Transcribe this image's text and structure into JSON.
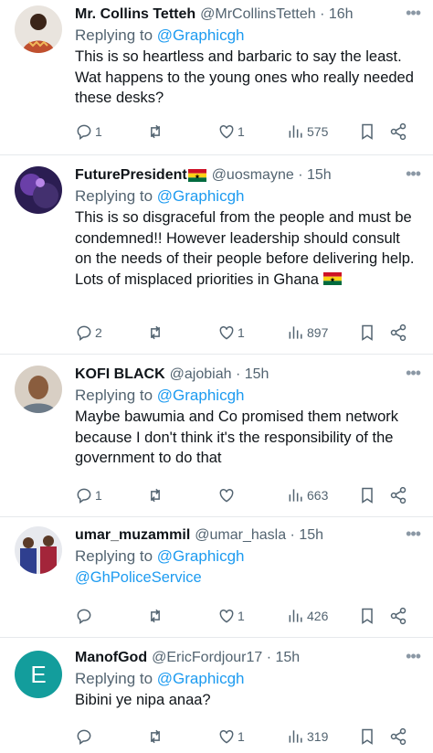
{
  "tweets": [
    {
      "name": "Mr. Collins Tetteh",
      "handle": "@MrCollinsTetteh · 16h",
      "reply_prefix": "Replying to ",
      "reply_to": "@Graphicgh",
      "text": "This is so heartless and barbaric to say the least. Wat happens to the young ones who really needed these desks?",
      "replies": "1",
      "retweets": "",
      "likes": "1",
      "views": "575",
      "avatar_color": "#c0502f"
    },
    {
      "name": "FuturePresident",
      "handle": "@uosmayne · 15h",
      "reply_prefix": "Replying to ",
      "reply_to": "@Graphicgh",
      "text": "This is so disgraceful from the people and must be condemned!! However leadership should consult on the needs of their people before delivering help. Lots of misplaced priorities in Ghana",
      "replies": "2",
      "retweets": "",
      "likes": "1",
      "views": "897",
      "avatar_color": "#3a2a6e"
    },
    {
      "name": "KOFI BLACK",
      "handle": "@ajobiah · 15h",
      "reply_prefix": "Replying to ",
      "reply_to": "@Graphicgh",
      "text": "Maybe bawumia and Co promised them network because I don't think it's the responsibility of the government to do that",
      "replies": "1",
      "retweets": "",
      "likes": "",
      "views": "663",
      "avatar_color": "#b59a80"
    },
    {
      "name": "umar_muzammil",
      "handle": "@umar_hasla · 15h",
      "reply_prefix": "Replying to ",
      "reply_to": "@Graphicgh",
      "text_link": "@GhPoliceService",
      "replies": "",
      "retweets": "",
      "likes": "1",
      "views": "426",
      "avatar_color": "#4a4f78"
    },
    {
      "name": "ManofGod",
      "handle": "@EricFordjour17 · 15h",
      "reply_prefix": "Replying to ",
      "reply_to": "@Graphicgh",
      "text": "Bibini ye nipa anaa?",
      "replies": "",
      "retweets": "",
      "likes": "1",
      "views": "319",
      "avatar_letter": "E",
      "avatar_color": "#139d9c"
    }
  ],
  "icons": {
    "reply": "reply-icon",
    "retweet": "retweet-icon",
    "like": "heart-icon",
    "views": "views-icon",
    "bookmark": "bookmark-icon",
    "share": "share-icon",
    "more": "more-icon"
  }
}
